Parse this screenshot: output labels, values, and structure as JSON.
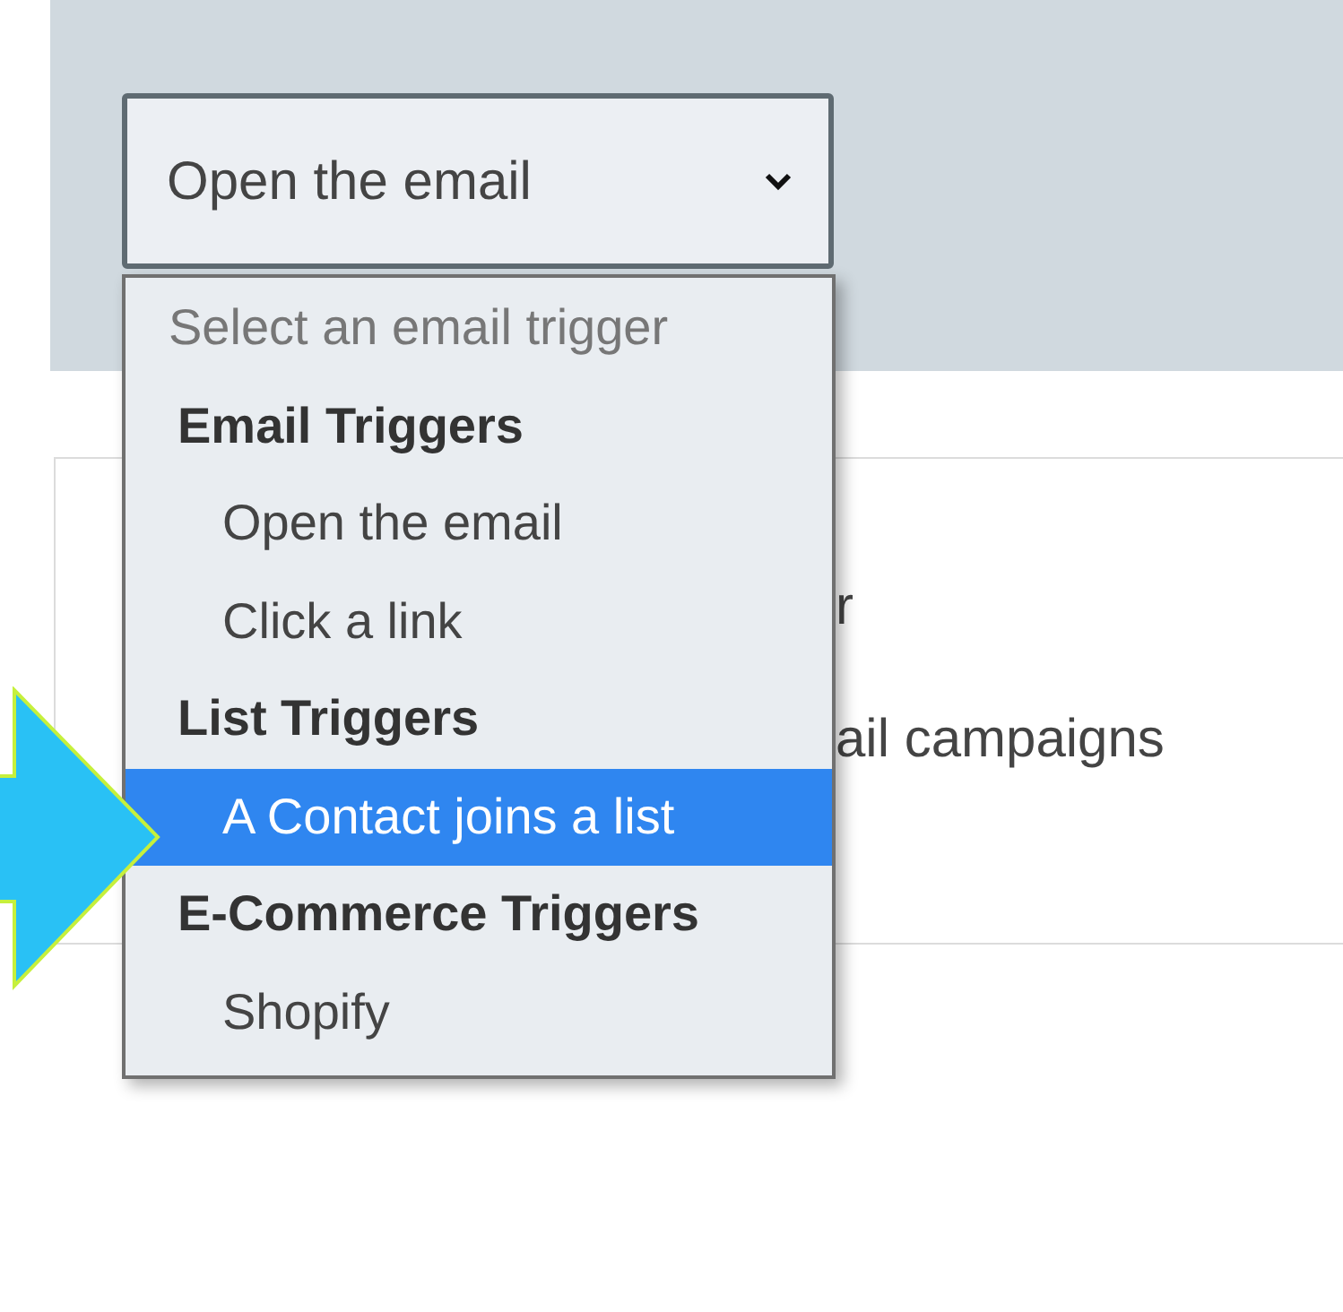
{
  "select": {
    "value": "Open the email"
  },
  "dropdown": {
    "placeholder": "Select an email trigger",
    "groups": [
      {
        "label": "Email Triggers",
        "options": [
          {
            "label": "Open the email",
            "selected": false
          },
          {
            "label": "Click a link",
            "selected": false
          }
        ]
      },
      {
        "label": "List Triggers",
        "options": [
          {
            "label": "A Contact joins a list",
            "selected": true
          }
        ]
      },
      {
        "label": "E-Commerce Triggers",
        "options": [
          {
            "label": "Shopify",
            "selected": false
          }
        ]
      }
    ]
  },
  "card": {
    "text_fragments": [
      "r",
      "ail campaigns"
    ]
  }
}
